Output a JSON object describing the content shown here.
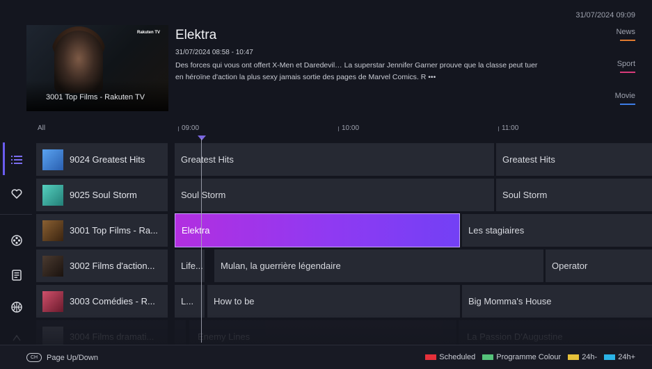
{
  "clock": "31/07/2024 09:09",
  "preview": {
    "channel_caption": "3001 Top Films - Rakuten TV",
    "logo_text": "Rakuten TV"
  },
  "info": {
    "title": "Elektra",
    "time": "31/07/2024 08:58 - 10:47",
    "description": "Des forces qui vous ont offert X-Men et Daredevil… La superstar Jennifer Garner prouve que la classe peut tuer en héroïne d'action la plus sexy jamais sortie des pages de Marvel Comics. R •••"
  },
  "filters": [
    {
      "label": "News",
      "color": "#e07a2f"
    },
    {
      "label": "Sport",
      "color": "#d83a7a"
    },
    {
      "label": "Movie",
      "color": "#3d7de6"
    }
  ],
  "timeline": {
    "all_label": "All",
    "ticks": [
      "09:00",
      "10:00",
      "11:00"
    ]
  },
  "sidebar": {
    "icons": [
      "list-icon",
      "heart-icon",
      "film-reel-icon",
      "document-icon",
      "sports-ball-icon",
      "other-icon"
    ]
  },
  "rows": [
    {
      "channel": "9024 Greatest Hits",
      "logo_color": "#4a8fd8",
      "programs": [
        {
          "title": "Greatest Hits"
        },
        {
          "title": "Greatest Hits"
        }
      ]
    },
    {
      "channel": "9025 Soul Storm",
      "logo_color": "#3fb4a6",
      "programs": [
        {
          "title": "Soul Storm"
        },
        {
          "title": "Soul Storm"
        }
      ]
    },
    {
      "channel": "3001 Top Films - Ra...",
      "logo_color": "#6b4a2a",
      "programs": [
        {
          "title": "Elektra"
        },
        {
          "title": "Les stagiaires"
        }
      ]
    },
    {
      "channel": "3002 Films d'action...",
      "logo_color": "#3a2a22",
      "programs": [
        {
          "title": "Life..."
        },
        {
          "title": "Mulan, la guerrière légendaire"
        },
        {
          "title": "Operator"
        }
      ]
    },
    {
      "channel": "3003 Comédies - R...",
      "logo_color": "#b0334f",
      "programs": [
        {
          "title": "L..."
        },
        {
          "title": "How to be"
        },
        {
          "title": "Big Momma's House"
        }
      ]
    },
    {
      "channel": "3004 Films dramati...",
      "logo_color": "#555a66",
      "programs": [
        {
          "title": ""
        },
        {
          "title": "Enemy Lines"
        },
        {
          "title": "La Passion D'Augustine"
        }
      ]
    }
  ],
  "footer": {
    "page_icon_text": "CH",
    "page_label": "Page Up/Down",
    "legend": [
      {
        "label": "Scheduled",
        "color": "#e5303a"
      },
      {
        "label": "Programme Colour",
        "color": "#55c27a"
      },
      {
        "label": "24h-",
        "color": "#e6c13a"
      },
      {
        "label": "24h+",
        "color": "#2bb3e6"
      }
    ]
  }
}
